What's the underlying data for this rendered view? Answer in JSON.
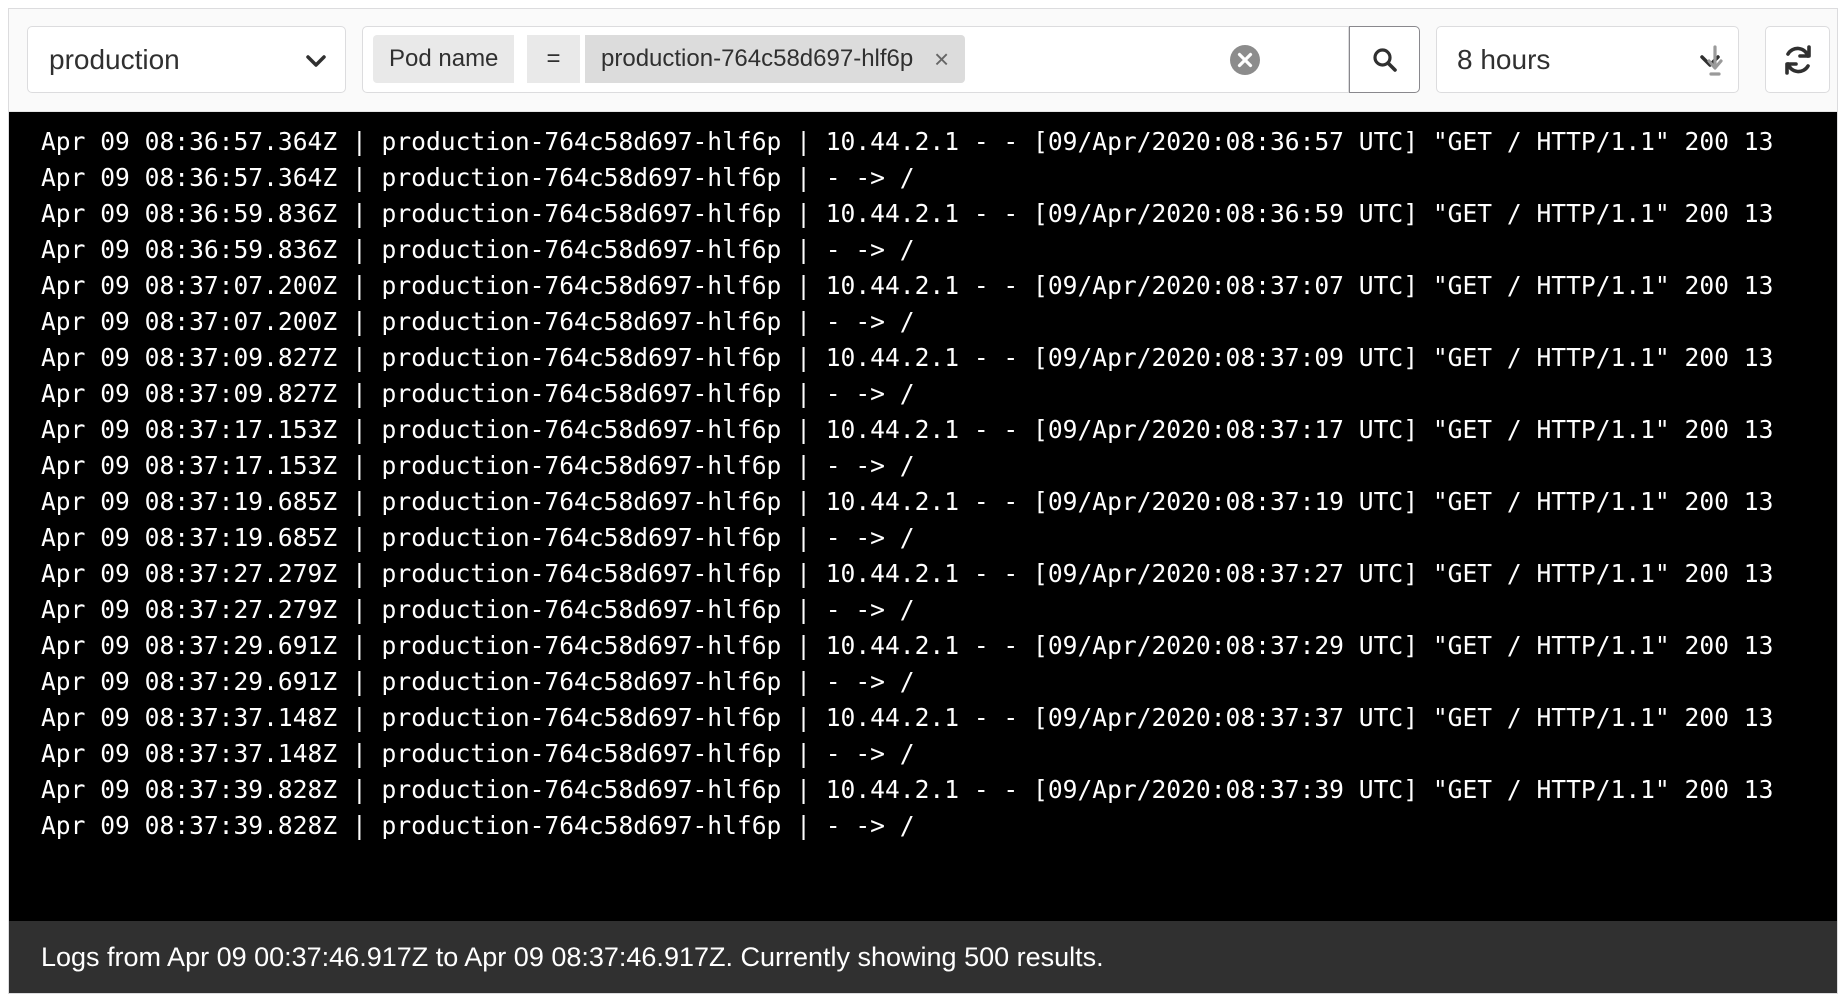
{
  "environment": {
    "selected": "production"
  },
  "filter": {
    "key": "Pod name",
    "operator": "=",
    "value": "production-764c58d697-hlf6p",
    "remove_glyph": "×"
  },
  "time_range": {
    "selected": "8 hours"
  },
  "icons": {
    "env_chevron": "chevron-down-icon",
    "clear": "clear-circle-icon",
    "search": "search-icon",
    "time_chevron": "chevron-down-icon",
    "scroll": "arrow-down-to-line-icon",
    "refresh": "refresh-icon"
  },
  "colors": {
    "log_background": "#000000",
    "log_text": "#ffffff",
    "status_background": "#303030"
  },
  "log_lines": [
    "Apr 09 08:36:57.364Z | production-764c58d697-hlf6p | 10.44.2.1 - - [09/Apr/2020:08:36:57 UTC] \"GET / HTTP/1.1\" 200 13",
    "Apr 09 08:36:57.364Z | production-764c58d697-hlf6p | - -> /",
    "Apr 09 08:36:59.836Z | production-764c58d697-hlf6p | 10.44.2.1 - - [09/Apr/2020:08:36:59 UTC] \"GET / HTTP/1.1\" 200 13",
    "Apr 09 08:36:59.836Z | production-764c58d697-hlf6p | - -> /",
    "Apr 09 08:37:07.200Z | production-764c58d697-hlf6p | 10.44.2.1 - - [09/Apr/2020:08:37:07 UTC] \"GET / HTTP/1.1\" 200 13",
    "Apr 09 08:37:07.200Z | production-764c58d697-hlf6p | - -> /",
    "Apr 09 08:37:09.827Z | production-764c58d697-hlf6p | 10.44.2.1 - - [09/Apr/2020:08:37:09 UTC] \"GET / HTTP/1.1\" 200 13",
    "Apr 09 08:37:09.827Z | production-764c58d697-hlf6p | - -> /",
    "Apr 09 08:37:17.153Z | production-764c58d697-hlf6p | 10.44.2.1 - - [09/Apr/2020:08:37:17 UTC] \"GET / HTTP/1.1\" 200 13",
    "Apr 09 08:37:17.153Z | production-764c58d697-hlf6p | - -> /",
    "Apr 09 08:37:19.685Z | production-764c58d697-hlf6p | 10.44.2.1 - - [09/Apr/2020:08:37:19 UTC] \"GET / HTTP/1.1\" 200 13",
    "Apr 09 08:37:19.685Z | production-764c58d697-hlf6p | - -> /",
    "Apr 09 08:37:27.279Z | production-764c58d697-hlf6p | 10.44.2.1 - - [09/Apr/2020:08:37:27 UTC] \"GET / HTTP/1.1\" 200 13",
    "Apr 09 08:37:27.279Z | production-764c58d697-hlf6p | - -> /",
    "Apr 09 08:37:29.691Z | production-764c58d697-hlf6p | 10.44.2.1 - - [09/Apr/2020:08:37:29 UTC] \"GET / HTTP/1.1\" 200 13",
    "Apr 09 08:37:29.691Z | production-764c58d697-hlf6p | - -> /",
    "Apr 09 08:37:37.148Z | production-764c58d697-hlf6p | 10.44.2.1 - - [09/Apr/2020:08:37:37 UTC] \"GET / HTTP/1.1\" 200 13",
    "Apr 09 08:37:37.148Z | production-764c58d697-hlf6p | - -> /",
    "Apr 09 08:37:39.828Z | production-764c58d697-hlf6p | 10.44.2.1 - - [09/Apr/2020:08:37:39 UTC] \"GET / HTTP/1.1\" 200 13",
    "Apr 09 08:37:39.828Z | production-764c58d697-hlf6p | - -> /"
  ],
  "status": {
    "text": "Logs from Apr 09 00:37:46.917Z to Apr 09 08:37:46.917Z. Currently showing 500 results."
  }
}
